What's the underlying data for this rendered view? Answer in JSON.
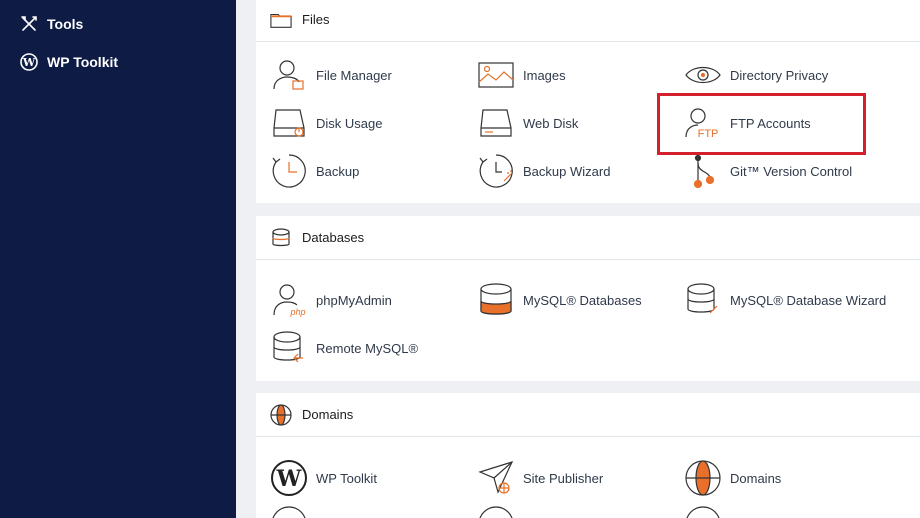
{
  "sidebar": {
    "items": [
      {
        "label": "Tools",
        "icon": "tools-icon"
      },
      {
        "label": "WP Toolkit",
        "icon": "wordpress-icon"
      }
    ]
  },
  "files": {
    "title": "Files",
    "items": [
      {
        "label": "File Manager",
        "icon": "file-manager-icon"
      },
      {
        "label": "Images",
        "icon": "images-icon"
      },
      {
        "label": "Directory Privacy",
        "icon": "eye-icon"
      },
      {
        "label": "Disk Usage",
        "icon": "disk-usage-icon"
      },
      {
        "label": "Web Disk",
        "icon": "web-disk-icon"
      },
      {
        "label": "FTP Accounts",
        "icon": "ftp-icon"
      },
      {
        "label": "Backup",
        "icon": "backup-icon"
      },
      {
        "label": "Backup Wizard",
        "icon": "backup-wizard-icon"
      },
      {
        "label": "Git™ Version Control",
        "icon": "git-icon"
      }
    ]
  },
  "databases": {
    "title": "Databases",
    "items": [
      {
        "label": "phpMyAdmin",
        "icon": "phpmyadmin-icon"
      },
      {
        "label": "MySQL® Databases",
        "icon": "mysql-icon"
      },
      {
        "label": "MySQL® Database Wizard",
        "icon": "mysql-wizard-icon"
      },
      {
        "label": "Remote MySQL®",
        "icon": "remote-mysql-icon"
      }
    ]
  },
  "domains": {
    "title": "Domains",
    "items": [
      {
        "label": "WP Toolkit",
        "icon": "wordpress-icon"
      },
      {
        "label": "Site Publisher",
        "icon": "site-publisher-icon"
      },
      {
        "label": "Domains",
        "icon": "globe-icon"
      }
    ]
  },
  "colors": {
    "sidebar_bg": "#0d1b45",
    "accent_orange": "#e8702a",
    "highlight_red": "#d4202a"
  }
}
